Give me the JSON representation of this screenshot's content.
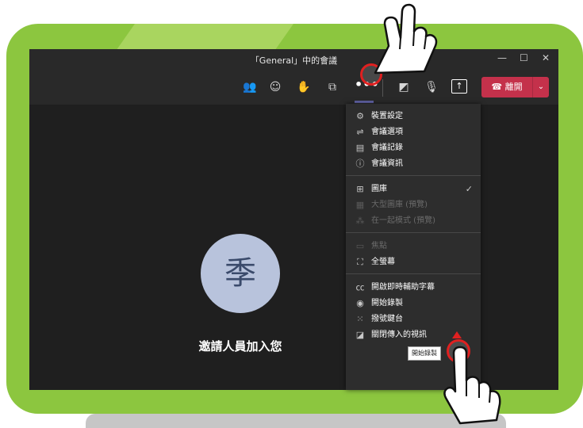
{
  "window": {
    "title": "「General」中的會議",
    "minimize": "—",
    "maximize": "☐",
    "close": "✕"
  },
  "toolbar": {
    "more": "•••",
    "share": "↑",
    "leave_label": "離開",
    "leave_icon": "☎",
    "leave_dropdown": "⌄",
    "icons": [
      "people-icon",
      "chat-icon",
      "raise-hand-icon",
      "rooms-icon",
      "camera-off-icon",
      "microphone-icon"
    ],
    "glyphs": {
      "people": "👥",
      "chat": "☺",
      "hand": "✋",
      "rooms": "⧉",
      "camera": "◩",
      "mic": "🎙"
    }
  },
  "participant": {
    "avatar_initial": "季",
    "invite_text": "邀請人員加入您"
  },
  "menu": {
    "groups": [
      [
        {
          "icon": "⚙",
          "label": "裝置設定",
          "disabled": false
        },
        {
          "icon": "⇌",
          "label": "會議選項",
          "disabled": false
        },
        {
          "icon": "▤",
          "label": "會議記錄",
          "disabled": false
        },
        {
          "icon": "ⓘ",
          "label": "會議資訊",
          "disabled": false
        }
      ],
      [
        {
          "icon": "⊞",
          "label": "圖庫",
          "disabled": false,
          "checked": true
        },
        {
          "icon": "▦",
          "label": "大型圖庫 (預覽)",
          "disabled": true
        },
        {
          "icon": "⁂",
          "label": "在一起模式 (預覽)",
          "disabled": true
        }
      ],
      [
        {
          "icon": "▭",
          "label": "焦點",
          "disabled": true
        },
        {
          "icon": "⛶",
          "label": "全螢幕",
          "disabled": false
        }
      ],
      [
        {
          "icon": "㏄",
          "label": "開啟即時輔助字幕",
          "disabled": false
        },
        {
          "icon": "◉",
          "label": "開始錄製",
          "disabled": false
        },
        {
          "icon": "⁙",
          "label": "撥號鍵台",
          "disabled": false
        },
        {
          "icon": "◪",
          "label": "關閉傳入的視訊",
          "disabled": false
        }
      ]
    ],
    "check_mark": "✓"
  },
  "tooltip": {
    "text": "開始錄製"
  },
  "colors": {
    "frame": "#8cc63f",
    "leave": "#c4314b",
    "accent": "#6264a7",
    "highlight": "#e02020"
  }
}
